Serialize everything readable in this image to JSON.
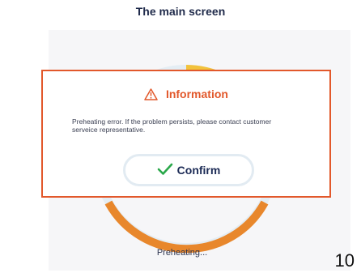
{
  "screen": {
    "title": "The main screen",
    "status_text": "Preheating...",
    "page_number": "10",
    "progress_ring": {
      "track_color": "#e4edf4",
      "arc_colors": [
        "#f0a63a",
        "#f2c23c",
        "#e8872c"
      ]
    }
  },
  "dialog": {
    "title": "Information",
    "message": "Preheating error. If the problem persists, please contact customer serveice representative.",
    "confirm_label": "Confirm",
    "accent_color": "#e2582b",
    "icons": {
      "header": "warning-triangle-icon",
      "confirm": "checkmark-icon"
    }
  }
}
